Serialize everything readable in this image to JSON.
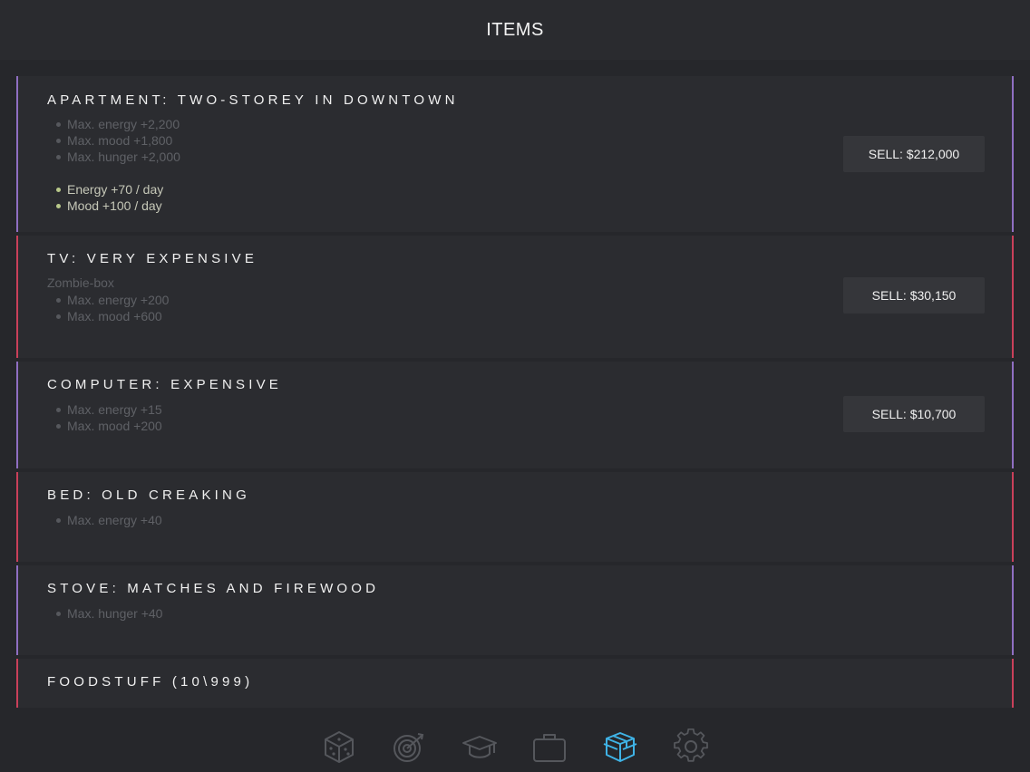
{
  "header": {
    "title": "ITEMS"
  },
  "items": [
    {
      "title": "APARTMENT: TWO-STOREY IN DOWNTOWN",
      "subtitle": "",
      "stats": [
        "Max. energy +2,200",
        "Max. mood +1,800",
        "Max. hunger +2,000"
      ],
      "daily": [
        "Energy +70 / day",
        "Mood +100 / day"
      ],
      "sell_label": "SELL: $212,000",
      "accent": "#8f6fc2"
    },
    {
      "title": "TV: VERY EXPENSIVE",
      "subtitle": "Zombie-box",
      "stats": [
        "Max. energy +200",
        "Max. mood +600"
      ],
      "daily": [],
      "sell_label": "SELL: $30,150",
      "accent": "#c9405a"
    },
    {
      "title": "COMPUTER: EXPENSIVE",
      "subtitle": "",
      "stats": [
        "Max. energy +15",
        "Max. mood +200"
      ],
      "daily": [],
      "sell_label": "SELL: $10,700",
      "accent": "#8f6fc2"
    },
    {
      "title": "BED: OLD CREAKING",
      "subtitle": "",
      "stats": [
        "Max. energy +40"
      ],
      "daily": [],
      "sell_label": "",
      "accent": "#c9405a"
    },
    {
      "title": "STOVE: MATCHES AND FIREWOOD",
      "subtitle": "",
      "stats": [
        "Max. hunger +40"
      ],
      "daily": [],
      "sell_label": "",
      "accent": "#8f6fc2"
    },
    {
      "title": "FOODSTUFF (10\\999)",
      "subtitle": "",
      "stats": [],
      "daily": [],
      "sell_label": "",
      "accent": "#c9405a"
    }
  ],
  "tabbar": {
    "tabs": [
      {
        "icon": "dice-icon",
        "active": false
      },
      {
        "icon": "target-icon",
        "active": false
      },
      {
        "icon": "graduation-cap-icon",
        "active": false
      },
      {
        "icon": "briefcase-icon",
        "active": false
      },
      {
        "icon": "box-icon",
        "active": true
      },
      {
        "icon": "gear-icon",
        "active": false
      }
    ],
    "active_color": "#3fb3e6",
    "inactive_color": "#55575c"
  }
}
